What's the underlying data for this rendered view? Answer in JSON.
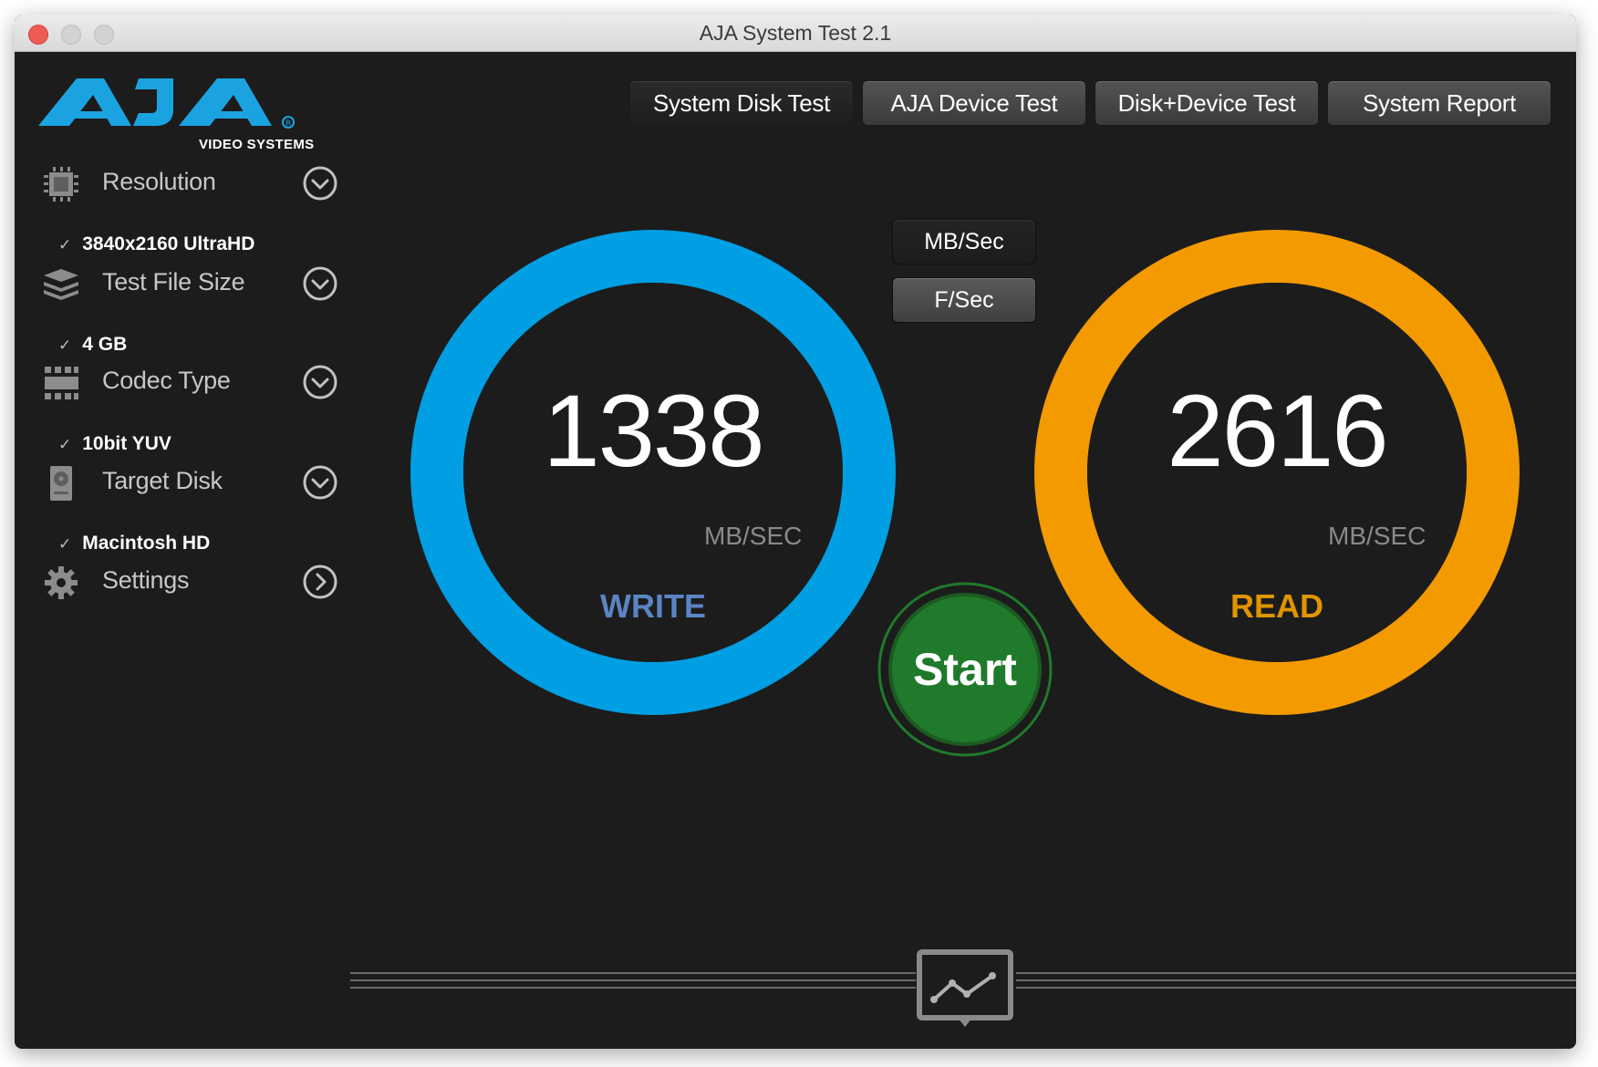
{
  "window": {
    "title": "AJA System Test 2.1"
  },
  "logo": {
    "brand": "AJA",
    "subtitle": "VIDEO SYSTEMS"
  },
  "tabs": [
    {
      "label": "System Disk Test",
      "active": true
    },
    {
      "label": "AJA Device Test",
      "active": false
    },
    {
      "label": "Disk+Device Test",
      "active": false
    },
    {
      "label": "System Report",
      "active": false
    }
  ],
  "sidebar": {
    "items": [
      {
        "label": "Resolution",
        "value": "3840x2160 UltraHD",
        "icon": "chip-icon"
      },
      {
        "label": "Test File Size",
        "value": "4 GB",
        "icon": "layers-icon"
      },
      {
        "label": "Codec Type",
        "value": "10bit YUV",
        "icon": "grid-icon"
      },
      {
        "label": "Target Disk",
        "value": "Macintosh HD",
        "icon": "hard-disk-icon"
      },
      {
        "label": "Settings",
        "icon": "gear-icon"
      }
    ]
  },
  "units": {
    "mb": "MB/Sec",
    "f": "F/Sec",
    "selected": "MB/Sec"
  },
  "write": {
    "value": "1338",
    "unit": "MB/SEC",
    "label": "WRITE",
    "ring_color": "#009ee2",
    "label_color": "#5b84c4"
  },
  "read": {
    "value": "2616",
    "unit": "MB/SEC",
    "label": "READ",
    "ring_color": "#f39a00",
    "label_color": "#e09400"
  },
  "start": {
    "label": "Start",
    "color": "#1f7a2b"
  },
  "bottom": {
    "icon": "graph-icon"
  }
}
